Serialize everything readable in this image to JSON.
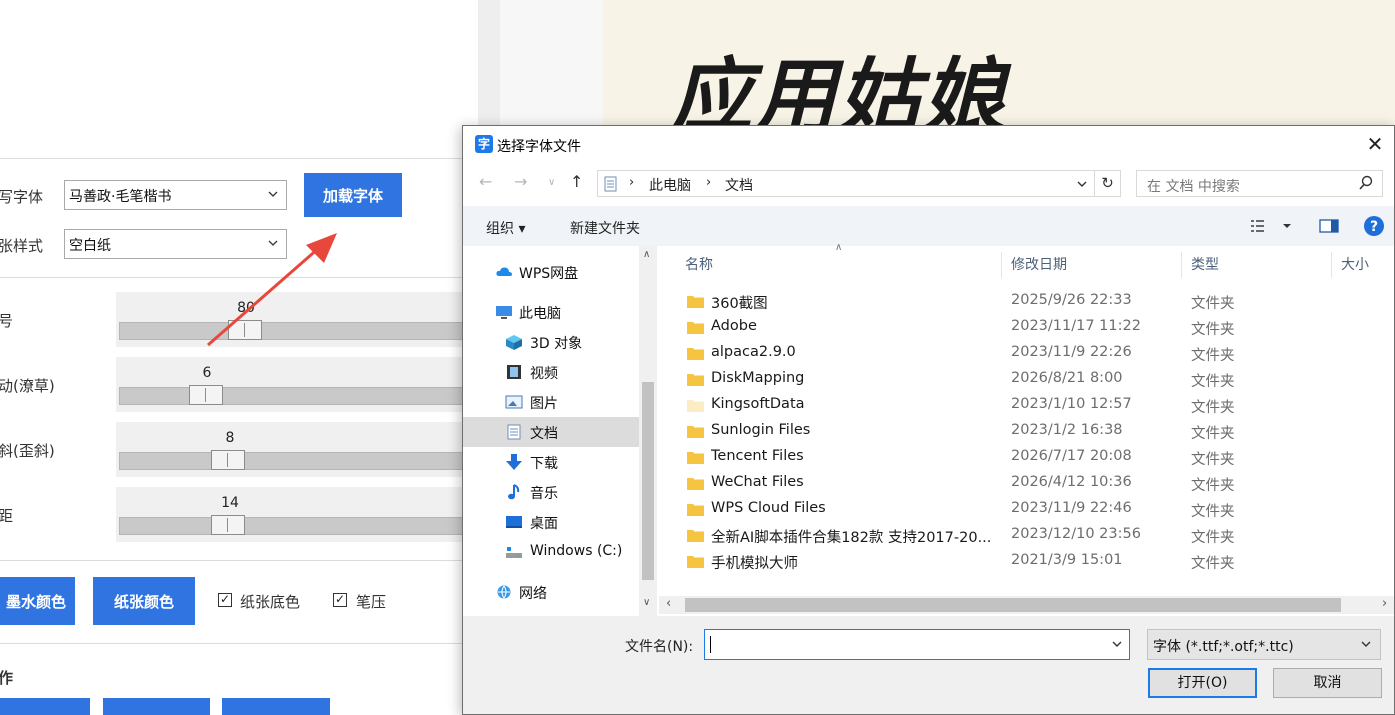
{
  "app": {
    "calligraphy_text": "应用姑娘",
    "font_label": "写字体",
    "font_value": "马善政·毛笔楷书",
    "load_font_button": "加载字体",
    "paper_label": "张样式",
    "paper_value": "空白纸",
    "size_label": "号",
    "size_value": "80",
    "jitter_label": "动(潦草)",
    "jitter_value": "6",
    "tilt_label": "斜(歪斜)",
    "tilt_value": "8",
    "spacing_label": "距",
    "spacing_value": "14",
    "ink_color_button": "墨水颜色",
    "paper_color_button": "纸张颜色",
    "paper_bg_check": "纸张底色",
    "pen_pressure_check": "笔压",
    "ops_title": "作"
  },
  "dialog": {
    "title": "选择字体文件",
    "breadcrumb": [
      "此电脑",
      "文档"
    ],
    "search_placeholder": "在 文档 中搜索",
    "toolbar": {
      "organize": "组织 ▾",
      "new_folder": "新建文件夹"
    },
    "nav": [
      {
        "label": "WPS网盘",
        "icon": "cloud-icon"
      },
      {
        "label": "此电脑",
        "icon": "computer-icon"
      },
      {
        "label": "3D 对象",
        "icon": "cube-icon"
      },
      {
        "label": "视频",
        "icon": "video-icon"
      },
      {
        "label": "图片",
        "icon": "picture-icon"
      },
      {
        "label": "文档",
        "icon": "document-icon"
      },
      {
        "label": "下载",
        "icon": "download-icon"
      },
      {
        "label": "音乐",
        "icon": "music-icon"
      },
      {
        "label": "桌面",
        "icon": "desktop-icon"
      },
      {
        "label": "Windows (C:)",
        "icon": "drive-icon"
      },
      {
        "label": "网络",
        "icon": "network-icon"
      }
    ],
    "columns": {
      "name": "名称",
      "date": "修改日期",
      "type": "类型",
      "size": "大小"
    },
    "files": [
      {
        "name": "360截图",
        "date": "2025/9/26 22:33",
        "type": "文件夹"
      },
      {
        "name": "Adobe",
        "date": "2023/11/17 11:22",
        "type": "文件夹"
      },
      {
        "name": "alpaca2.9.0",
        "date": "2023/11/9 22:26",
        "type": "文件夹"
      },
      {
        "name": "DiskMapping",
        "date": "2026/8/21 8:00",
        "type": "文件夹"
      },
      {
        "name": "KingsoftData",
        "date": "2023/1/10 12:57",
        "type": "文件夹"
      },
      {
        "name": "Sunlogin Files",
        "date": "2023/1/2 16:38",
        "type": "文件夹"
      },
      {
        "name": "Tencent Files",
        "date": "2026/7/17 20:08",
        "type": "文件夹"
      },
      {
        "name": "WeChat Files",
        "date": "2026/4/12 10:36",
        "type": "文件夹"
      },
      {
        "name": "WPS Cloud Files",
        "date": "2023/11/9 22:46",
        "type": "文件夹"
      },
      {
        "name": "全新AI脚本插件合集182款 支持2017-20...",
        "date": "2023/12/10 23:56",
        "type": "文件夹"
      },
      {
        "name": "手机模拟大师",
        "date": "2021/3/9 15:01",
        "type": "文件夹"
      }
    ],
    "filename_label": "文件名(N):",
    "filename_value": "",
    "filetype_value": "字体 (*.ttf;*.otf;*.ttc)",
    "open_button": "打开(O)",
    "cancel_button": "取消",
    "colors": {
      "accent": "#1e7ae8",
      "folder": "#f5c542",
      "app_blue": "#2f74e0"
    }
  }
}
